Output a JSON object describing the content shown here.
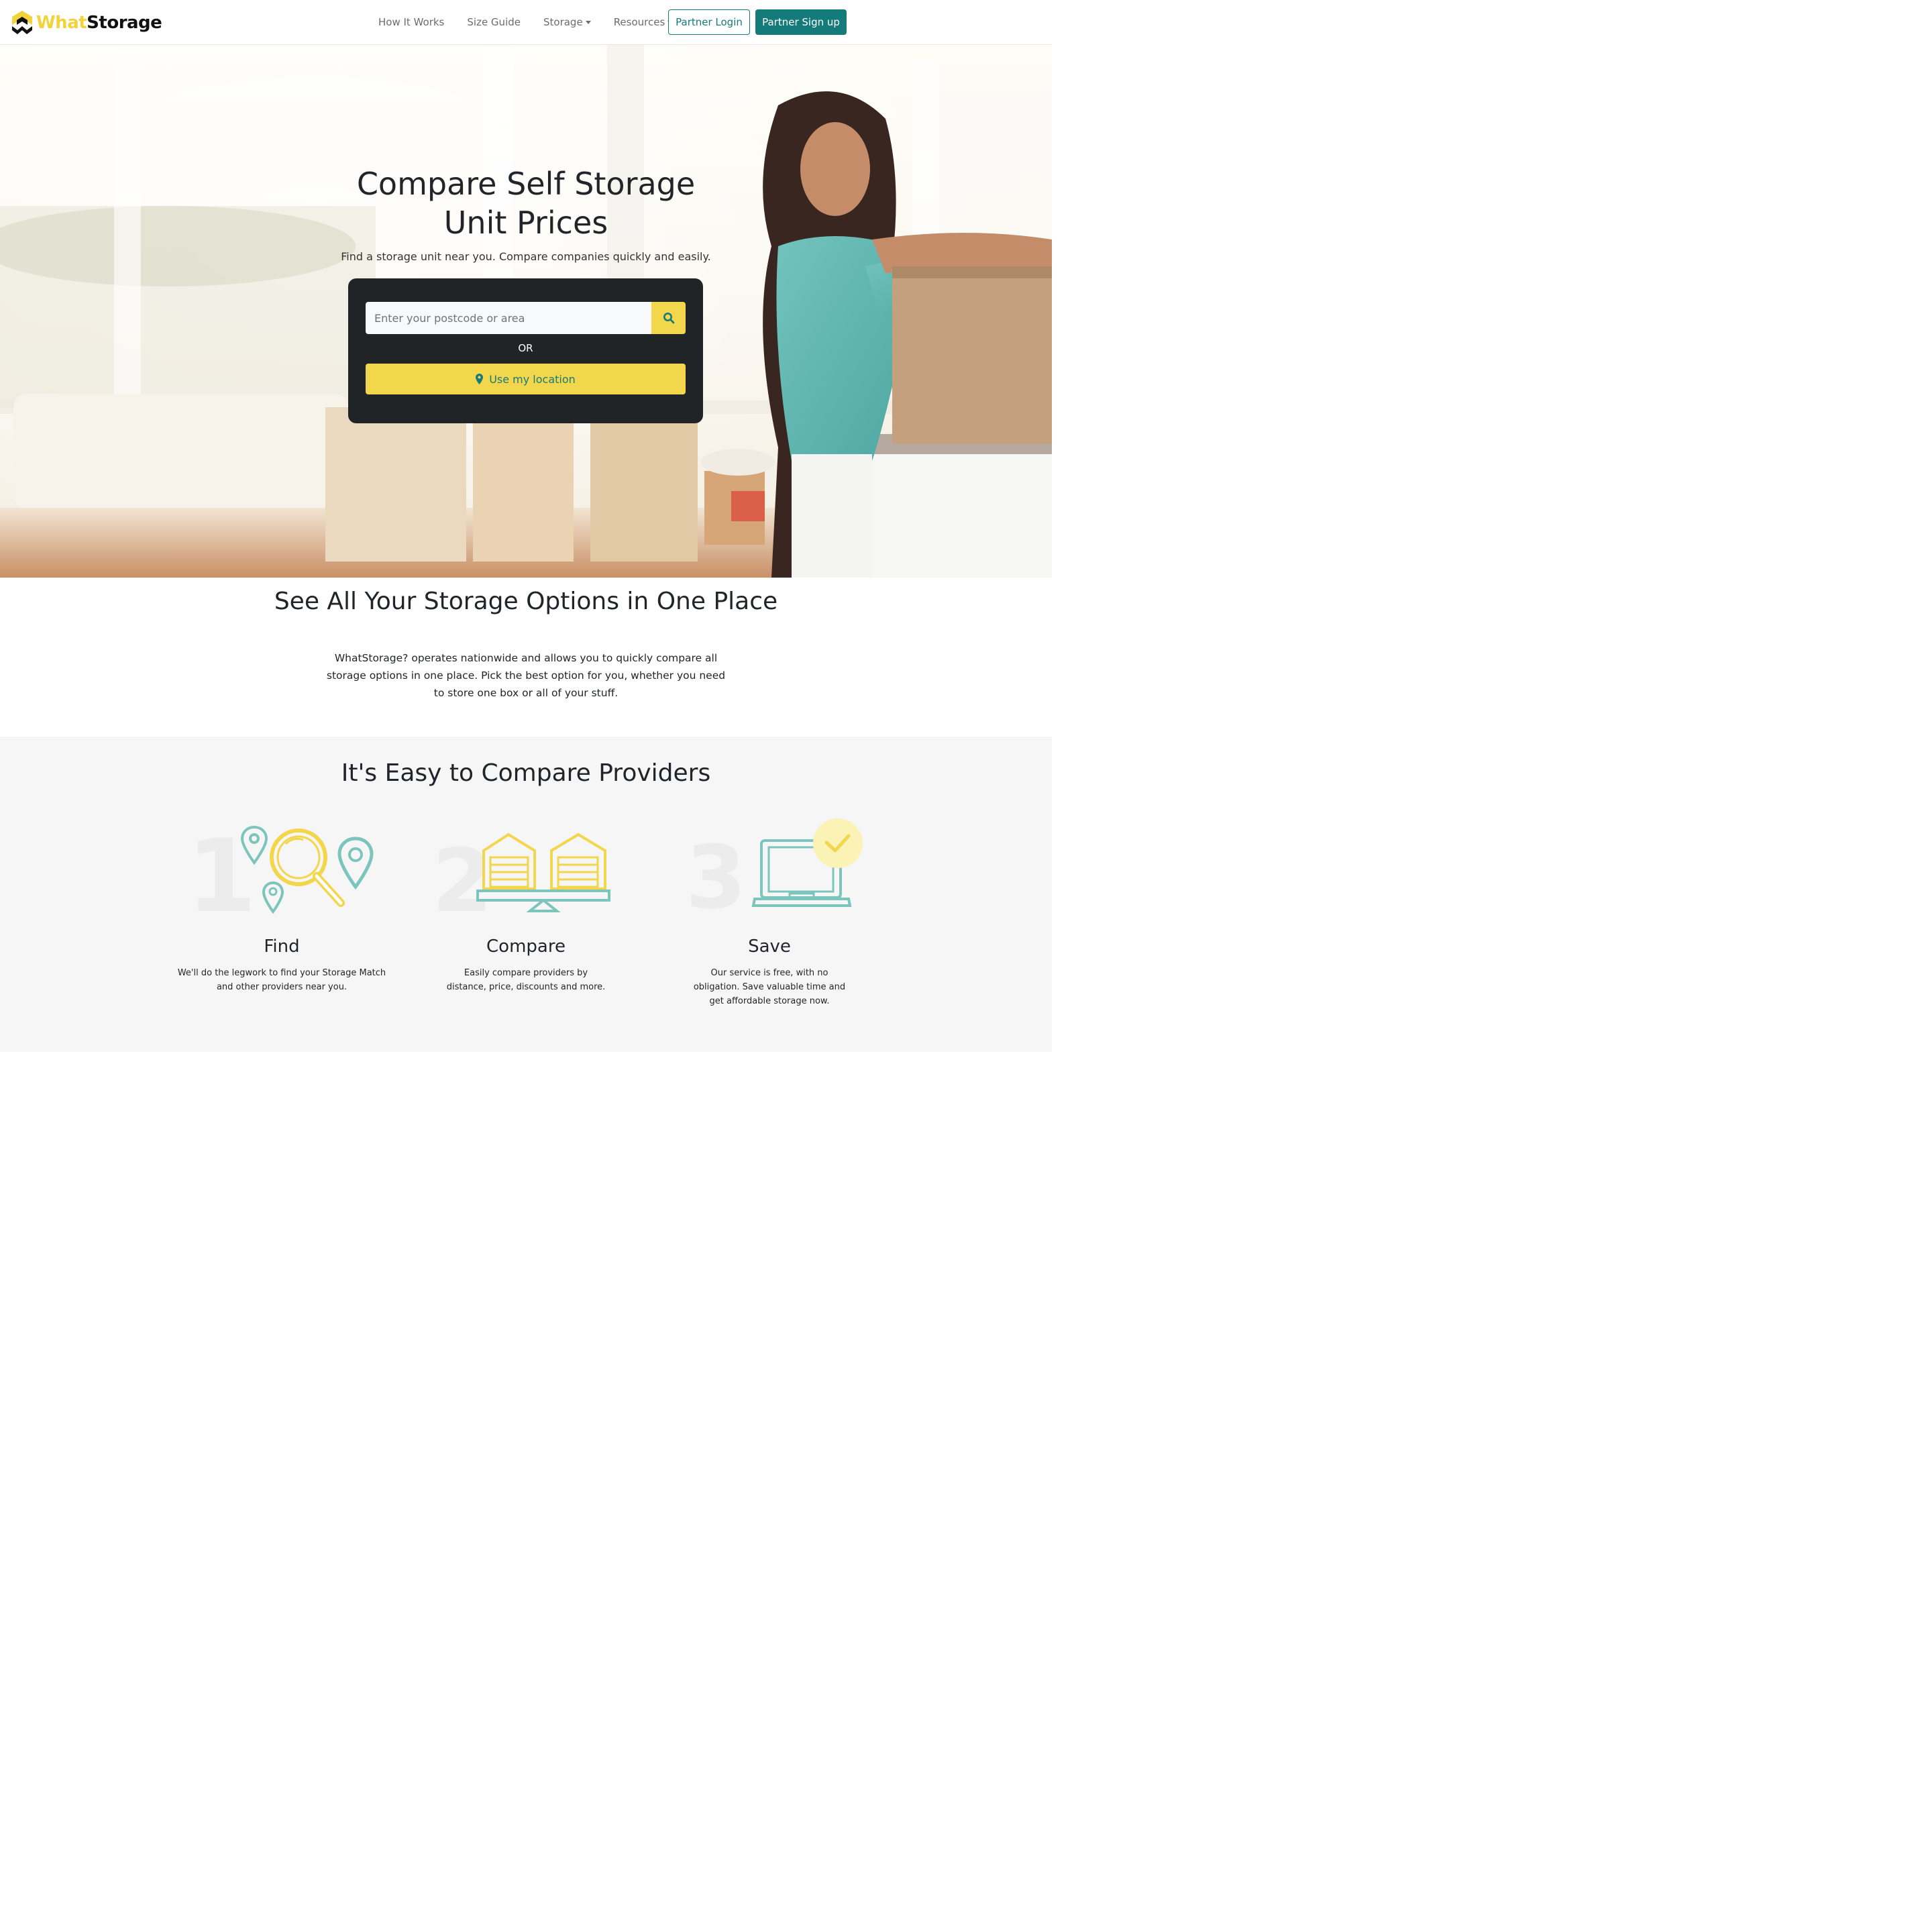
{
  "brand": {
    "what": "What",
    "storage": "Storage"
  },
  "nav": {
    "links": [
      "How It Works",
      "Size Guide",
      "Storage",
      "Resources"
    ],
    "login": "Partner Login",
    "signup": "Partner Sign up"
  },
  "hero": {
    "title_line1": "Compare Self Storage",
    "title_line2": "Unit Prices",
    "subtitle": "Find a storage unit near you. Compare companies quickly and easily.",
    "search_placeholder": "Enter your postcode or area",
    "or": "OR",
    "location_button": "Use my location"
  },
  "options": {
    "title": "See All Your Storage Options in One Place",
    "text": "WhatStorage? operates nationwide and allows you to quickly compare all storage options in one place. Pick the best option for you, whether you need to store one box or all of your stuff."
  },
  "providers": {
    "title": "It's Easy to Compare Providers",
    "steps": [
      {
        "number": "1",
        "title": "Find",
        "lines": [
          "We'll do the legwork to find your Storage Match",
          "and other providers near you."
        ]
      },
      {
        "number": "2",
        "title": "Compare",
        "lines": [
          "Easily compare providers by",
          "distance, price, discounts and more."
        ]
      },
      {
        "number": "3",
        "title": "Save",
        "lines": [
          "Our service is free, with no",
          "obligation. Save valuable time and",
          "get affordable storage now."
        ]
      }
    ]
  },
  "colors": {
    "teal": "#157a7a",
    "yellow": "#f2d64b",
    "dark": "#212427"
  },
  "icons": {
    "search": "search-icon",
    "location": "map-marker-icon"
  }
}
